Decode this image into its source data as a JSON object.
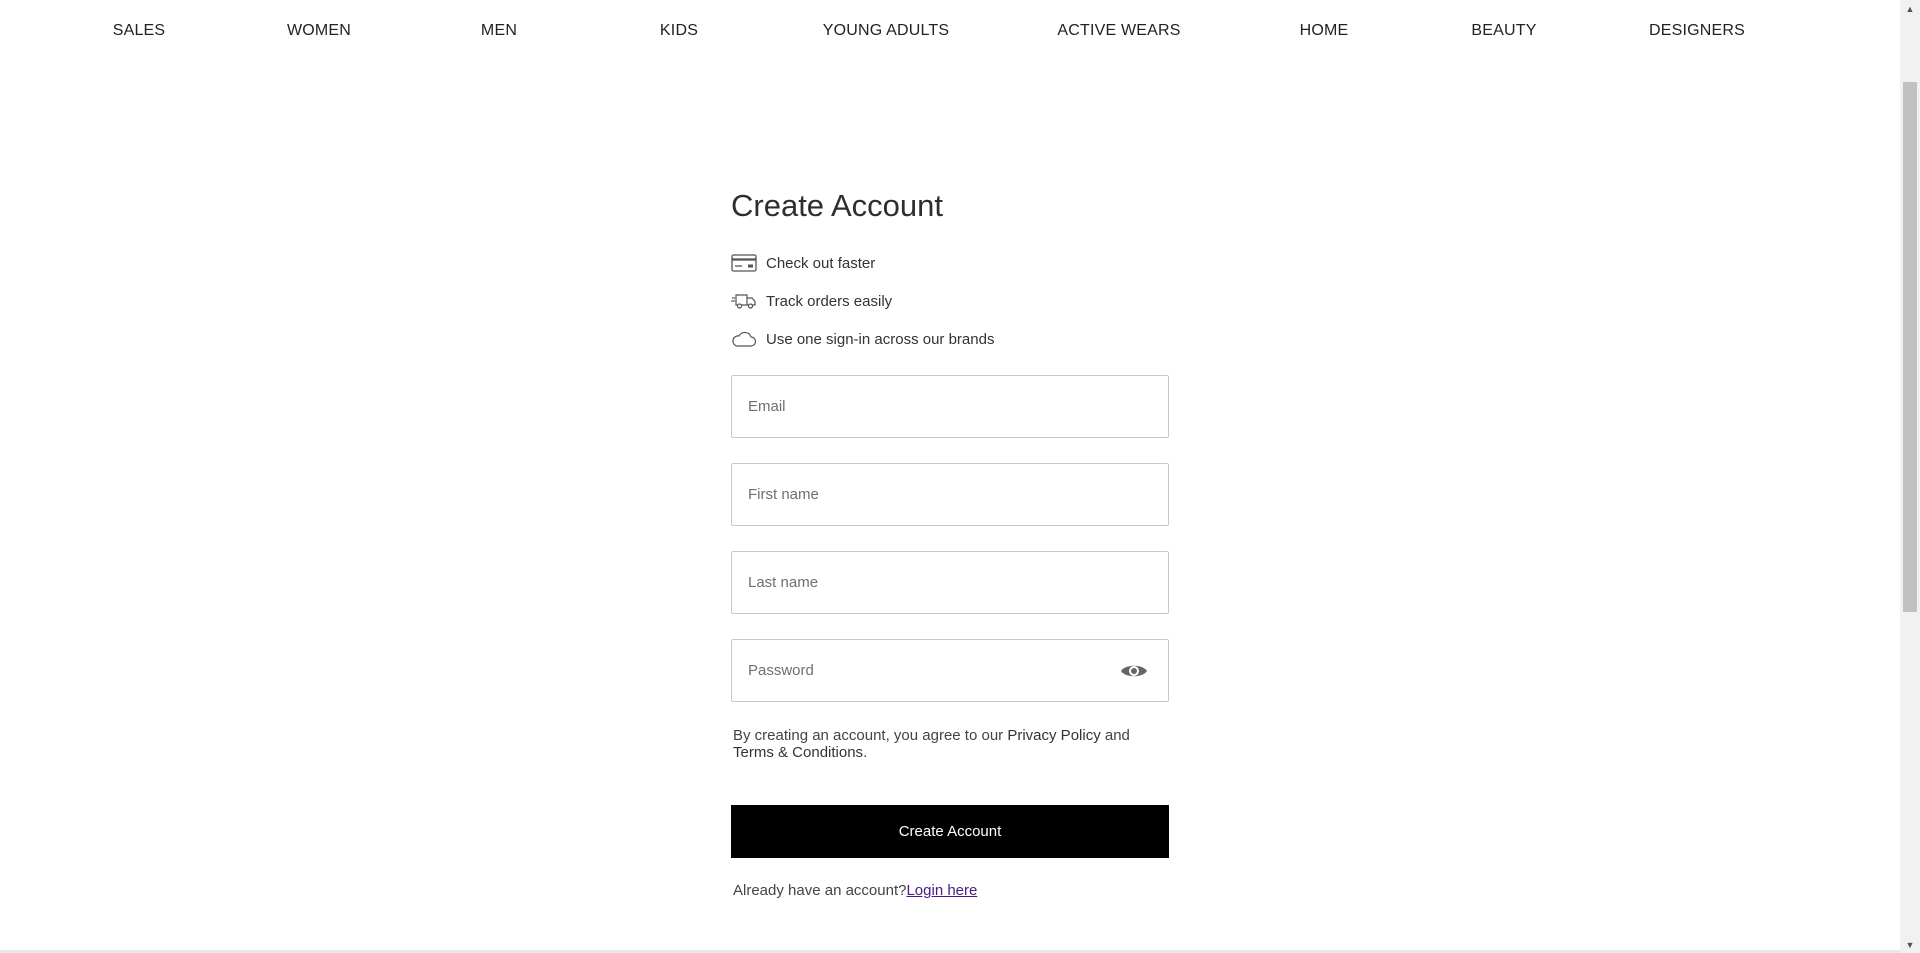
{
  "nav": {
    "items": [
      {
        "label": "SALES"
      },
      {
        "label": "WOMEN"
      },
      {
        "label": "MEN"
      },
      {
        "label": "KIDS"
      },
      {
        "label": "YOUNG ADULTS"
      },
      {
        "label": "ACTIVE WEARS"
      },
      {
        "label": "HOME"
      },
      {
        "label": "BEAUTY"
      },
      {
        "label": "DESIGNERS"
      }
    ]
  },
  "form": {
    "title": "Create Account",
    "benefits": [
      {
        "icon": "credit-card-icon",
        "text": "Check out faster"
      },
      {
        "icon": "delivery-truck-icon",
        "text": "Track orders easily"
      },
      {
        "icon": "cloud-icon",
        "text": "Use one sign-in across our brands"
      }
    ],
    "fields": {
      "email": {
        "placeholder": "Email",
        "value": ""
      },
      "first_name": {
        "placeholder": "First name",
        "value": ""
      },
      "last_name": {
        "placeholder": "Last name",
        "value": ""
      },
      "password": {
        "placeholder": "Password",
        "value": "",
        "toggle_icon": "eye-icon"
      }
    },
    "legal": {
      "prefix": "By creating an account, you agree to our ",
      "privacy": "Privacy Policy",
      "middle": " and ",
      "terms": "Terms & Conditions",
      "suffix": "."
    },
    "submit_label": "Create Account",
    "login": {
      "prompt": "Already have an account?",
      "link": "Login here"
    }
  },
  "colors": {
    "button_bg": "#000000",
    "button_text": "#ffffff",
    "link": "#4a1b80",
    "border": "#c7c7c7"
  }
}
